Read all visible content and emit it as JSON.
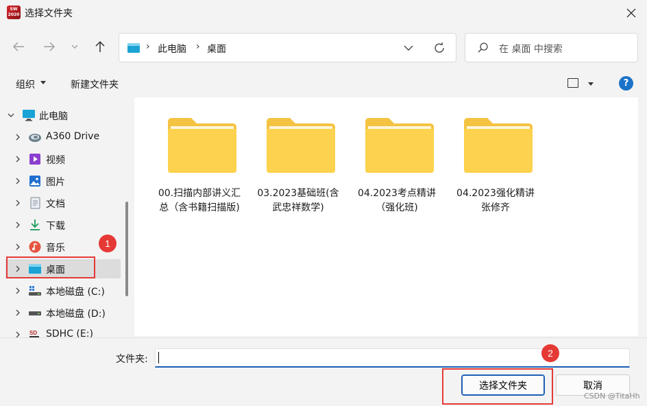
{
  "window": {
    "title": "选择文件夹",
    "app_icon_text": "SW 2020",
    "accent": "#1a5fb4"
  },
  "navbar": {
    "back_icon": "arrow-left-icon",
    "forward_icon": "arrow-right-icon",
    "recent_icon": "chevron-down-icon",
    "up_icon": "arrow-up-icon",
    "breadcrumb": [
      "此电脑",
      "桌面"
    ],
    "search_placeholder": "在 桌面 中搜索"
  },
  "toolbar": {
    "organize_label": "组织",
    "new_folder_label": "新建文件夹",
    "help_label": "?"
  },
  "nav_tree": [
    {
      "label": "此电脑",
      "icon": "monitor-icon",
      "expanded": true,
      "root": true
    },
    {
      "label": "A360 Drive",
      "icon": "cloud-drive-icon"
    },
    {
      "label": "视频",
      "icon": "video-icon"
    },
    {
      "label": "图片",
      "icon": "picture-icon"
    },
    {
      "label": "文档",
      "icon": "document-icon"
    },
    {
      "label": "下载",
      "icon": "download-icon"
    },
    {
      "label": "音乐",
      "icon": "music-icon"
    },
    {
      "label": "桌面",
      "icon": "desktop-icon",
      "selected": true
    },
    {
      "label": "本地磁盘 (C:)",
      "icon": "windows-drive-icon"
    },
    {
      "label": "本地磁盘 (D:)",
      "icon": "drive-icon"
    },
    {
      "label": "SDHC (E:)",
      "icon": "sd-card-icon"
    }
  ],
  "folders": [
    {
      "name": "00.扫描内部讲义汇总（含书籍扫描版)"
    },
    {
      "name": "03.2023基础班(含武忠祥数学)"
    },
    {
      "name": "04.2023考点精讲（强化班)"
    },
    {
      "name": "04.2023强化精讲 张修齐"
    }
  ],
  "bottom": {
    "folder_label": "文件夹:",
    "folder_value": "",
    "select_button": "选择文件夹",
    "cancel_button": "取消",
    "watermark": "CSDN @TitaHh"
  },
  "annotations": {
    "marker_1": "1",
    "marker_2": "2",
    "color": "#e53935"
  }
}
